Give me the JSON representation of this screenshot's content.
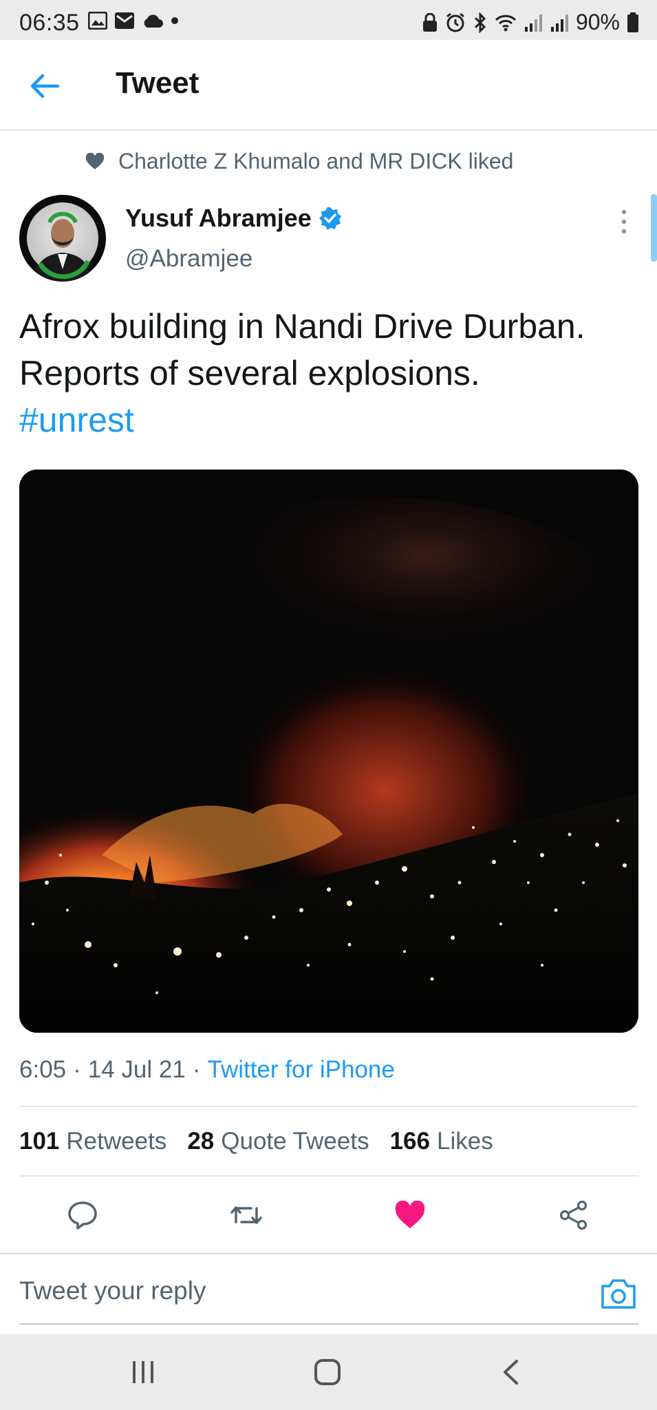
{
  "status_bar": {
    "time": "06:35",
    "battery": "90%",
    "left_icons": [
      "image-icon",
      "mail-icon",
      "cloud-icon",
      "dot-icon"
    ],
    "right_icons": [
      "lock-icon",
      "alarm-icon",
      "bluetooth-icon",
      "wifi-icon",
      "signal-icon",
      "signal-icon",
      "battery-icon"
    ]
  },
  "header": {
    "title": "Tweet"
  },
  "social_context": {
    "text": "Charlotte Z Khumalo and MR DICK liked"
  },
  "author": {
    "name": "Yusuf Abramjee",
    "handle": "@Abramjee",
    "verified": true
  },
  "tweet": {
    "line1": "Afrox building in Nandi Drive Durban.",
    "line2": "Reports of several explosions.",
    "hashtag": "#unrest"
  },
  "meta": {
    "time": "6:05",
    "sep1": "·",
    "date": "14 Jul 21",
    "sep2": "·",
    "client": "Twitter for iPhone"
  },
  "stats": {
    "retweets_count": "101",
    "retweets_label": "Retweets",
    "quotes_count": "28",
    "quotes_label": "Quote Tweets",
    "likes_count": "166",
    "likes_label": "Likes"
  },
  "actions": [
    "reply-icon",
    "retweet-icon",
    "like-icon",
    "share-icon"
  ],
  "reply": {
    "placeholder": "Tweet your reply"
  },
  "colors": {
    "accent": "#1d9bf0",
    "like": "#f91880",
    "secondary_text": "#536471",
    "divider": "#e1e8ed"
  }
}
